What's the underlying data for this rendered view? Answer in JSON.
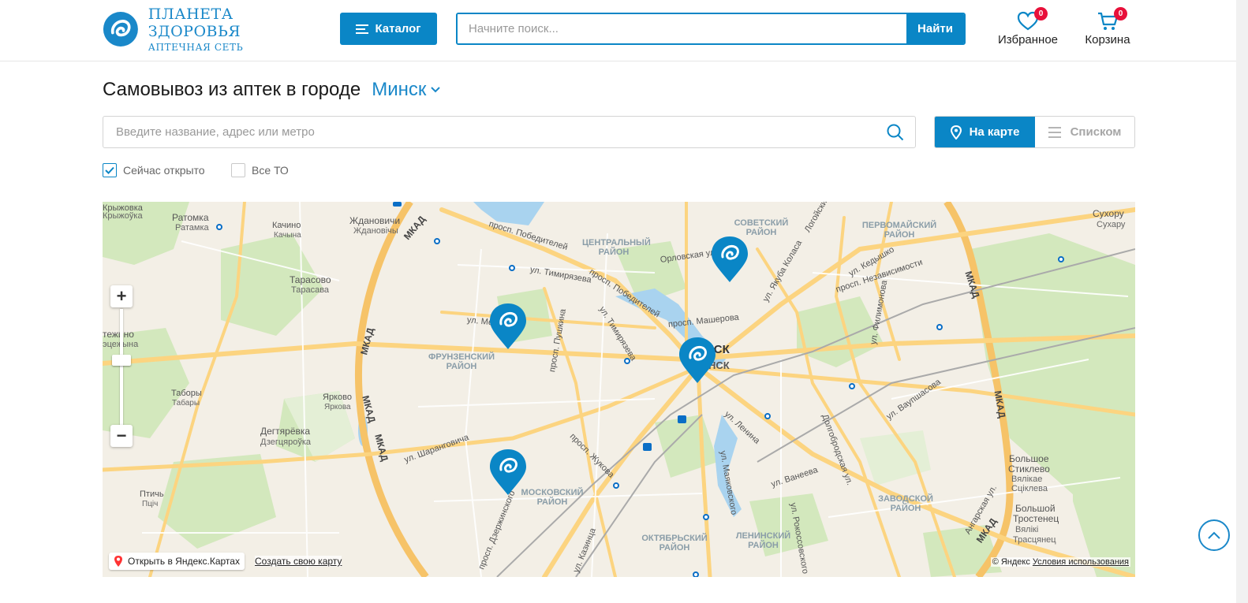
{
  "header": {
    "logo_name": "ПЛАНЕТА ЗДОРОВЬЯ",
    "logo_sub": "АПТЕЧНАЯ СЕТЬ",
    "catalog_label": "Каталог",
    "search_placeholder": "Начните поиск...",
    "search_button": "Найти",
    "favorites_label": "Избранное",
    "favorites_count": "0",
    "cart_label": "Корзина",
    "cart_count": "0"
  },
  "page": {
    "title": "Самовывоз из аптек в городе",
    "city": "Минск",
    "filter_placeholder": "Введите название, адрес или метро",
    "view_map": "На карте",
    "view_list": "Списком",
    "checkbox_open": "Сейчас открыто",
    "checkbox_open_checked": true,
    "checkbox_all": "Все ТО",
    "checkbox_all_checked": false
  },
  "map": {
    "places": [
      "Крыжовка",
      "Крыжоўка",
      "Ратомка",
      "Ратамка",
      "Качино",
      "Качына",
      "Ждановичи",
      "Ждановічы",
      "Тарасово",
      "Тарасава",
      "Тростенец",
      "тежино",
      "эцежына",
      "Таборы",
      "Табары",
      "Ярково",
      "Яркова",
      "Дегтярёвка",
      "Дзегцяроўка",
      "Птичь",
      "Пціч",
      "Сухору",
      "Сухару",
      "Большое",
      "Стиклево",
      "Вялікае",
      "Сціклева",
      "Большой",
      "Тростенец",
      "Вялікі",
      "Трасцянец"
    ],
    "districts": [
      "ЦЕНТРАЛЬНЫЙ РАЙОН",
      "СОВЕТСКИЙ РАЙОН",
      "ПЕРВОМАЙСКИЙ РАЙОН",
      "ФРУНЗЕНСКИЙ РАЙОН",
      "МОСКОВСКИЙ РАЙОН",
      "ЗАВОДСКОЙ РАЙОН",
      "ЛЕНИНСКИЙ РАЙОН",
      "ОКТЯБРЬСКИЙ РАЙОН"
    ],
    "streets": [
      "просп. Победителей",
      "ул. Тимирязева",
      "просп. Победителей",
      "Орловская ул.",
      "ул. Якуба Коласа",
      "Логойский",
      "ул. Кедышко",
      "просп. Независимости",
      "ул. Тимирязева",
      "просп. Машерова",
      "просп. Пушкина",
      "ул. Мел",
      "ул. Филимонова",
      "ул. Шаранговича",
      "просп. Жукова",
      "ул. Ленина",
      "Долгобродская ул.",
      "ул. Ваупшасова",
      "просп. Дзержинского",
      "ул. Маяковского",
      "ул. Ванеева",
      "ул. Рокоссовского",
      "ул. Казинца",
      "Ангарская ул."
    ],
    "ring_road": "МКАД",
    "city_label_1": "ИСК",
    "city_label_2": "НСК",
    "pharmacy_pins_count": 4,
    "open_in_yandex": "Открыть в Яндекс.Картах",
    "create_map": "Создать свою карту",
    "copyright": "© Яндекс",
    "terms": "Условия использования"
  },
  "colors": {
    "brand": "#0a86c6",
    "logo": "#1a88c9",
    "badge": "#e8103a",
    "map_bg": "#f3efe6",
    "water": "#a9d3ef",
    "green": "#cfe6b5",
    "road": "#fcd480"
  }
}
